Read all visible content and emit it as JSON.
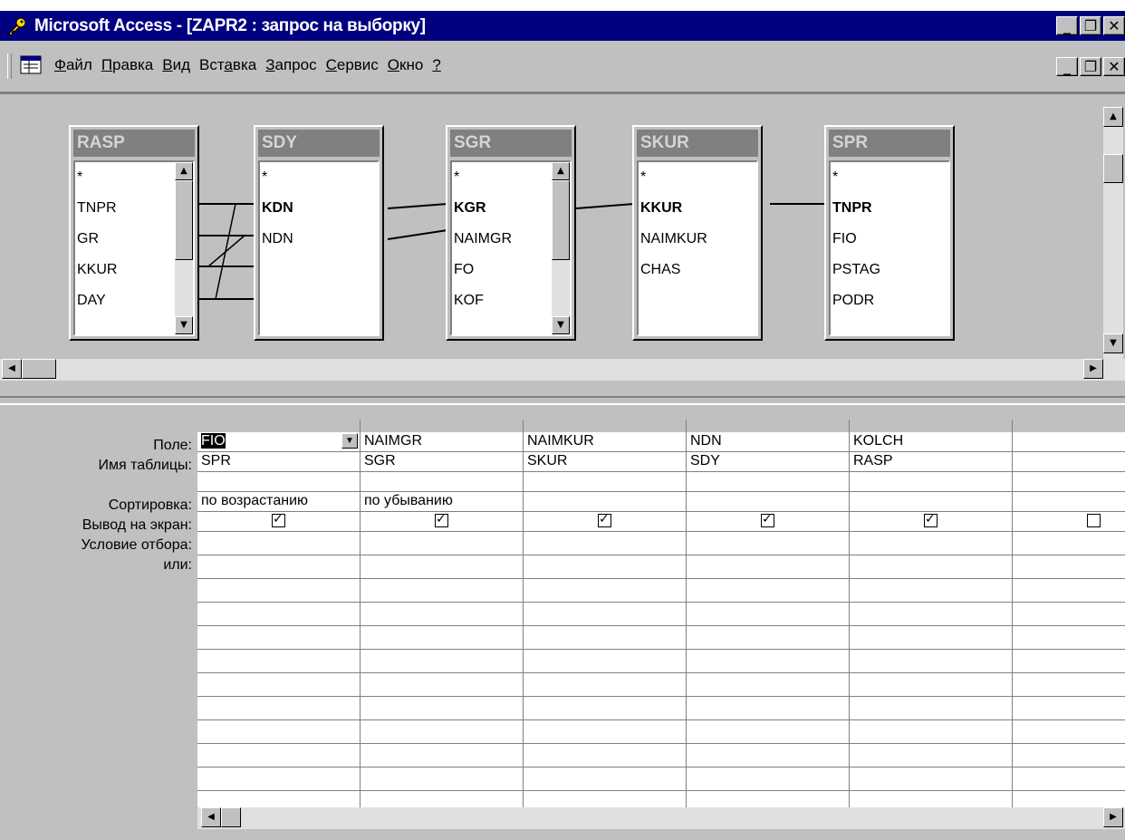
{
  "window": {
    "title": "Microsoft Access - [ZAPR2 : запрос на выборку]"
  },
  "menu": {
    "items": [
      {
        "underline": "Ф",
        "rest": "айл"
      },
      {
        "underline": "П",
        "rest": "равка"
      },
      {
        "underline": "В",
        "rest": "ид"
      },
      {
        "pre": "Вст",
        "underline": "а",
        "rest": "вка"
      },
      {
        "underline": "З",
        "rest": "апрос"
      },
      {
        "underline": "С",
        "rest": "ервис"
      },
      {
        "underline": "О",
        "rest": "кно"
      },
      {
        "underline": "?",
        "rest": ""
      }
    ]
  },
  "tables": [
    {
      "name": "RASP",
      "fields": [
        "*",
        "TNPR",
        "GR",
        "KKUR",
        "DAY"
      ],
      "keys": [],
      "scroll": true
    },
    {
      "name": "SDY",
      "fields": [
        "*",
        "KDN",
        "NDN"
      ],
      "keys": [
        "KDN"
      ],
      "scroll": false
    },
    {
      "name": "SGR",
      "fields": [
        "*",
        "KGR",
        "NAIMGR",
        "FO",
        "KOF"
      ],
      "keys": [
        "KGR"
      ],
      "scroll": true
    },
    {
      "name": "SKUR",
      "fields": [
        "*",
        "KKUR",
        "NAIMKUR",
        "CHAS"
      ],
      "keys": [
        "KKUR"
      ],
      "scroll": false
    },
    {
      "name": "SPR",
      "fields": [
        "*",
        "TNPR",
        "FIO",
        "PSTAG",
        "PODR"
      ],
      "keys": [
        "TNPR"
      ],
      "scroll": false
    }
  ],
  "grid": {
    "row_labels": {
      "field": "Поле:",
      "table": "Имя таблицы:",
      "sort": "Сортировка:",
      "show": "Вывод на экран:",
      "criteria": "Условие отбора:",
      "or": "или:"
    },
    "columns": [
      {
        "field": "FIO",
        "table": "SPR",
        "sort": "по возрастанию",
        "show": true
      },
      {
        "field": "NAIMGR",
        "table": "SGR",
        "sort": "по убыванию",
        "show": true
      },
      {
        "field": "NAIMKUR",
        "table": "SKUR",
        "sort": "",
        "show": true
      },
      {
        "field": "NDN",
        "table": "SDY",
        "sort": "",
        "show": true
      },
      {
        "field": "KOLCH",
        "table": "RASP",
        "sort": "",
        "show": true
      },
      {
        "field": "",
        "table": "",
        "sort": "",
        "show": false
      }
    ]
  },
  "icons": {
    "app": "access-key-icon",
    "document": "query-design-icon"
  },
  "colors": {
    "titlebar": "#000080",
    "face": "#c0c0c0",
    "table_title": "#808080"
  }
}
